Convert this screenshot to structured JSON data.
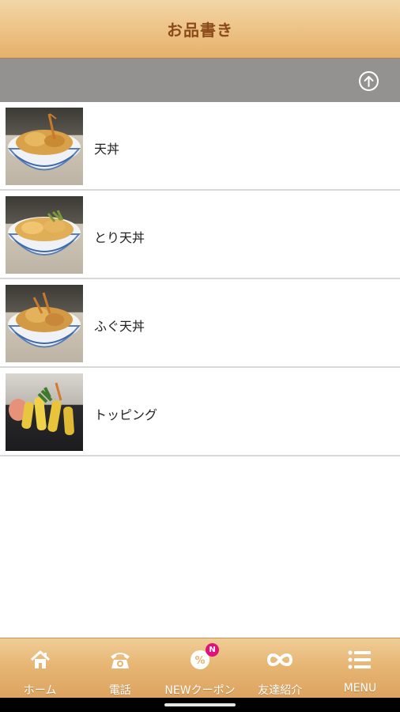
{
  "header": {
    "title": "お品書き"
  },
  "subbar": {
    "up_icon": "arrow-up-circle-icon"
  },
  "menu_items": [
    {
      "label": "天丼",
      "image": "tendon-photo"
    },
    {
      "label": "とり天丼",
      "image": "tori-tendon-photo"
    },
    {
      "label": "ふぐ天丼",
      "image": "fugu-tendon-photo"
    },
    {
      "label": "トッピング",
      "image": "topping-tempura-photo"
    }
  ],
  "bottom_nav": [
    {
      "label": "ホーム",
      "icon": "home-icon"
    },
    {
      "label": "電話",
      "icon": "phone-icon"
    },
    {
      "label": "NEWクーポン",
      "icon": "coupon-icon",
      "badge": "N"
    },
    {
      "label": "友達紹介",
      "icon": "infinity-icon"
    },
    {
      "label": "MENU",
      "icon": "menu-list-icon"
    }
  ],
  "colors": {
    "header_text": "#8a4a1a",
    "subbar_bg": "#939290",
    "badge": "#e0117a",
    "nav_text": "#ffffff"
  }
}
